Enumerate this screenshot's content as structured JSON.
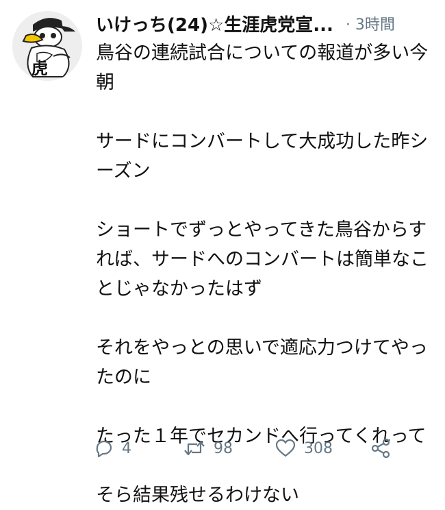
{
  "tweet": {
    "user": {
      "display_name": "いけっち(24)☆生涯虎党宣...",
      "avatar_icon": "duck-tiger-avatar-icon",
      "avatar_kanji": "虎"
    },
    "time": "· 3時間",
    "paragraphs": [
      "鳥谷の連続試合についての報道が多い今朝",
      "サードにコンバートして大成功した昨シーズン",
      "ショートでずっとやってきた鳥谷からすれば、サードへのコンバートは簡単なことじゃなかったはず",
      "それをやっとの思いで適応力つけてやったのに",
      "たった１年でセカンドへ行ってくれって",
      "そら結果残せるわけない"
    ],
    "actions": {
      "reply_count": "4",
      "retweet_count": "98",
      "like_count": "308",
      "reply_icon": "reply-icon",
      "retweet_icon": "retweet-icon",
      "like_icon": "heart-icon",
      "share_icon": "share-icon"
    }
  }
}
